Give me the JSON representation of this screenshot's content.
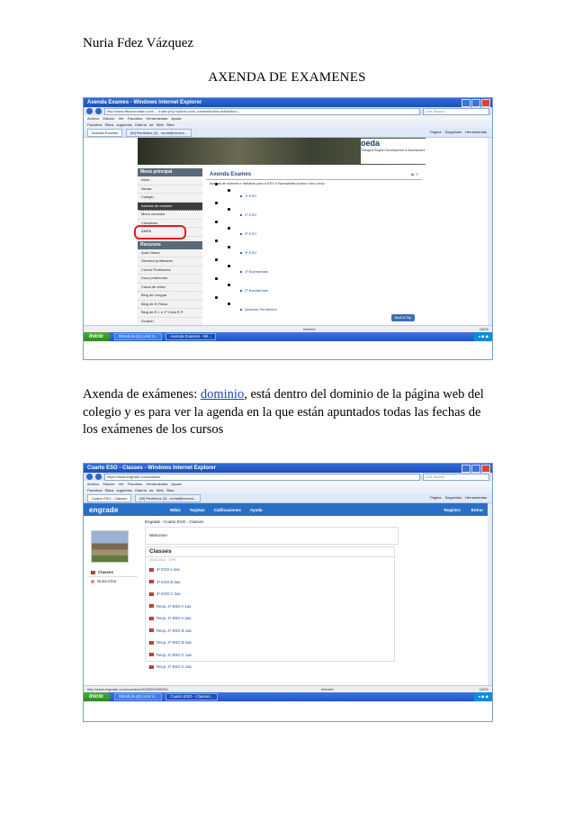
{
  "doc": {
    "author": "Nuria Fdez Vázquez",
    "title": "AXENDA DE EXAMENES",
    "para_prefix": "Axenda de exámenes: ",
    "para_link": "dominio",
    "para_suffix": ", está dentro del dominio de la página web del colegio y es para ver la agenda en la que están apuntados todas las fechas de los exámenes de los cursos"
  },
  "shot1": {
    "window_title": "Axenda Exames - Windows Internet Explorer",
    "url": "http://www.fftcoconuttac.com/  ...  index.php?option=com_content&view=article&id=...",
    "search_placeholder": "Live Search",
    "menu": "Archivo   Edición   Ver   Favoritos   Herramientas   Ayuda",
    "favorites": "Favoritos   Sitios sugeridos   Galería de Web Slice",
    "tab1": "Axenda Exames",
    "tab2": "[M] Recibidos (3) - nuriaf@cevam...",
    "toolbar_right": "Página   Seguridad   Herramientas",
    "logo_text": "oeda",
    "logo_sub": "Trilingual English Development & Assessment",
    "nav_header_1": "Menú principal",
    "nav_items_1": [
      "Inicio",
      "Novas",
      "Colegio",
      "Axenda de exames",
      "Menu comedor",
      "Circulares",
      "AMPA"
    ],
    "nav_header_2": "Recursos",
    "nav_items_2": [
      "Aula Virtual",
      "Servidor profesores",
      "Correo Profesores",
      "Docs profesores",
      "Canal de vídeo",
      "Blog de Lengua",
      "Blog de E.Física",
      "Blog de E.I. e 1º Ciclo E.P.",
      "Scratch"
    ],
    "content_title": "Axenda Exames",
    "content_desc": "Axenda de exames e traballos para a ESO e Bacharelato;busca o teu curso:",
    "course_links": [
      "1º ESO",
      "2º ESO",
      "3º ESO",
      "4º ESO",
      "1º Bacharelato",
      "2º Bacharelato",
      "Materias Pendentes"
    ],
    "back_to_top": "Back to Top",
    "status_zone": "Internet",
    "zoom": "100%",
    "start": "Inicio",
    "task1": "GNU/LIN (E) UAS V...",
    "task2": "Axenda Exames - Wi..."
  },
  "shot2": {
    "window_title": "Cuarto ESO - Classes - Windows Internet Explorer",
    "url": "https://www.engrade.com/classes",
    "search_placeholder": "Live Search",
    "menu": "Archivo   Edición   Ver   Favoritos   Herramientas   Ayuda",
    "favorites": "Favoritos   Sitios sugeridos   Galería de Web Slice",
    "tab1": "Cuarto ESO - Classes",
    "tab2": "[M] Recibidos (3) - nuriaf@cevam...",
    "toolbar_right": "Página   Seguridad   Herramientas",
    "logo": "engrade",
    "nav": [
      "Wikis",
      "Tarjetas",
      "Calificaciones",
      "Ayuda"
    ],
    "right_nav": [
      "Registro",
      "Entrar"
    ],
    "breadcrumb": "Engrade › Cuarto ESO › Classes",
    "sidebar": [
      "Classes",
      "Nuria Irma"
    ],
    "welcome": "Welcome!",
    "classes_header": "Classes",
    "classes_sub": "2013-2014 · GPS",
    "classes": [
      "4º ESO A 2av",
      "4º ESO B 2av",
      "4º ESO C 2av",
      "Recp. 4º ESO A 1av",
      "Recp. 4º ESO A 2av",
      "Recp. 4º ESO B 1av",
      "Recp. 4º ESO B 2av",
      "Recp. 4º ESO C 1av",
      "Recp. 4º ESO C 2av"
    ],
    "status_url": "http://www.engrade.com/cuarteso/D000000000001",
    "status_zone": "Internet",
    "zoom": "100%",
    "start": "Inicio",
    "task1": "GNU/LIN (E) UAS V...",
    "task2": "Cuarto ESO - Classes..."
  }
}
